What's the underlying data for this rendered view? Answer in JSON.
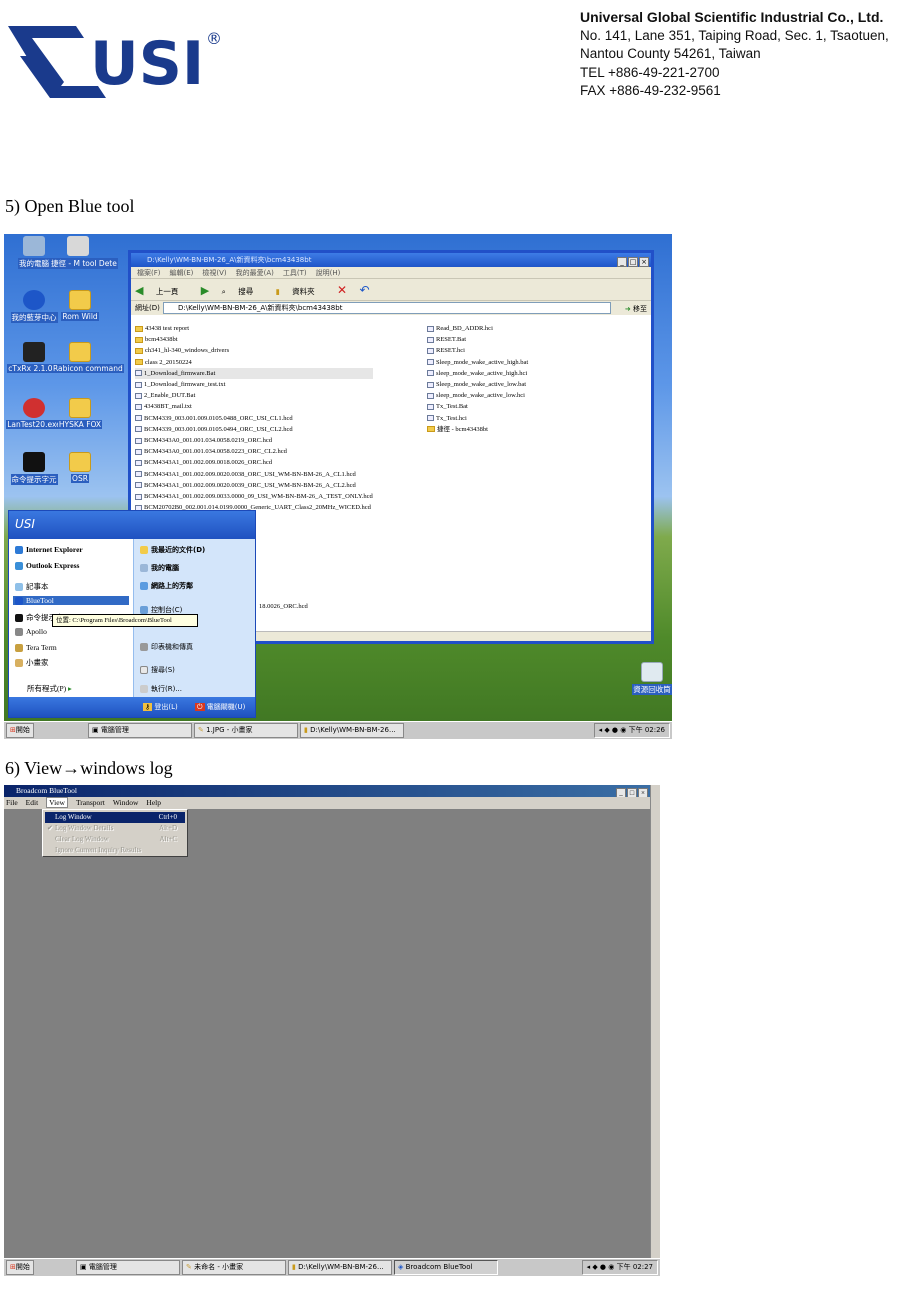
{
  "header": {
    "logo_text": "USI",
    "logo_mark": "®",
    "company_name": "Universal Global Scientific Industrial Co., Ltd.",
    "address_line1": "No. 141, Lane 351, Taiping Road, Sec. 1, Tsaotuen,",
    "address_line2": "Nantou County 54261, Taiwan",
    "tel": "TEL  +886-49-221-2700",
    "fax": "FAX +886-49-232-9561"
  },
  "step5": {
    "label": "5)   Open Blue tool"
  },
  "step6": {
    "label_before": "6)   View",
    "arrow": "→",
    "label_after": "windows log"
  },
  "screenshot1": {
    "desktop_icons": [
      "我的電腦",
      "捷徑 - M tool Dete",
      "我的藍芽中心",
      "Rom Wild",
      "cTxRx 2.1.0.0",
      "Rabicon command",
      "LanTest20.exe",
      "HYSKA FOX",
      "命令提示字元",
      "OSR",
      "資源回收筒"
    ],
    "explorer": {
      "title": "D:\\Kelly\\WM-BN-BM-26_A\\新資料夾\\bcm43438bt",
      "menus": [
        "檔案(F)",
        "編輯(E)",
        "檢視(V)",
        "我的最愛(A)",
        "工具(T)",
        "說明(H)"
      ],
      "toolbar": [
        "上一頁",
        "搜尋",
        "資料夾"
      ],
      "address_label": "網址(D)",
      "address_value": "D:\\Kelly\\WM-BN-BM-26_A\\新資料夾\\bcm43438bt",
      "go_label": "移至",
      "files_left": [
        "43438 test report",
        "bcm43438bt",
        "ch341_hl-340_windows_drivers",
        "class 2_20150224",
        "1_Download_firmware.Bat",
        "1_Download_firmware_test.txt",
        "2_Enable_DUT.Bat",
        "43438BT_mail.txt",
        "BCM4339_003.001.009.0105.0488_ORC_USI_CL1.hcd",
        "BCM4339_003.001.009.0105.0494_ORC_USI_CL2.hcd",
        "BCM4343A0_001.001.034.0058.0219_ORC.hcd",
        "BCM4343A0_001.001.034.0058.0223_ORC_CL2.hcd",
        "BCM4343A1_001.002.009.0018.0026_ORC.hcd",
        "BCM4343A1_001.002.009.0020.0038_ORC_USI_WM-BN-BM-26_A_CL1.hcd",
        "BCM4343A1_001.002.009.0020.0039_ORC_USI_WM-BN-BM-26_A_CL2.hcd",
        "BCM4343A1_001.002.009.0033.0000_09_USI_WM-BN-BM-26_A_TEST_ONLY.hcd",
        "BCM20702B0_002.001.014.0199.0000_Generic_UART_Class2_20MHz_WICED.hcd"
      ],
      "files_right": [
        "Read_BD_ADDR.hci",
        "RESET.Bat",
        "RESET.hci",
        "Sleep_mode_wake_active_high.bat",
        "sleep_mode_wake_active_high.hci",
        "Sleep_mode_wake_active_low.bat",
        "sleep_mode_wake_active_low.hci",
        "Tx_Test.Bat",
        "Tx_Test.hci",
        "捷徑 - bcm43438bt"
      ],
      "partial_file": "18.0026_ORC.hcd"
    },
    "start_menu": {
      "user": "USI",
      "left_items": [
        "Internet Explorer",
        "Outlook Express",
        "記事本",
        "BlueTool",
        "命令提示字元",
        "Apollo",
        "Tera Term",
        "小畫家"
      ],
      "all_programs": "所有程式(P)",
      "right_items": [
        "我最近的文件(D)",
        "我的電腦",
        "網路上的芳鄰",
        "控制台(C)",
        "印表機和傳真",
        "搜尋(S)",
        "執行(R)..."
      ],
      "logoff": "登出(L)",
      "shutdown": "電腦關機(U)"
    },
    "tooltip": "位置: C:\\Program Files\\Broadcom\\BlueTool",
    "taskbar": {
      "start": "開始",
      "buttons": [
        "電腦管理",
        "1.JPG - 小畫家",
        "D:\\Kelly\\WM-BN-BM-26..."
      ],
      "clock": "下午 02:26"
    }
  },
  "screenshot2": {
    "title": "Broadcom BlueTool",
    "menus": [
      "File",
      "Edit",
      "View",
      "Transport",
      "Window",
      "Help"
    ],
    "view_menu": [
      {
        "label": "Log Window",
        "shortcut": "Ctrl+0"
      },
      {
        "label": "Log Window Details",
        "shortcut": "Alt+D"
      },
      {
        "label": "Clear Log Window",
        "shortcut": "Alt+C"
      },
      {
        "label": "Ignore Current Inquiry Results",
        "shortcut": ""
      }
    ],
    "taskbar": {
      "start": "開始",
      "buttons": [
        "電腦管理",
        "未命名 - 小畫家",
        "D:\\Kelly\\WM-BN-BM-26...",
        "Broadcom BlueTool"
      ],
      "clock": "下午 02:27"
    }
  }
}
